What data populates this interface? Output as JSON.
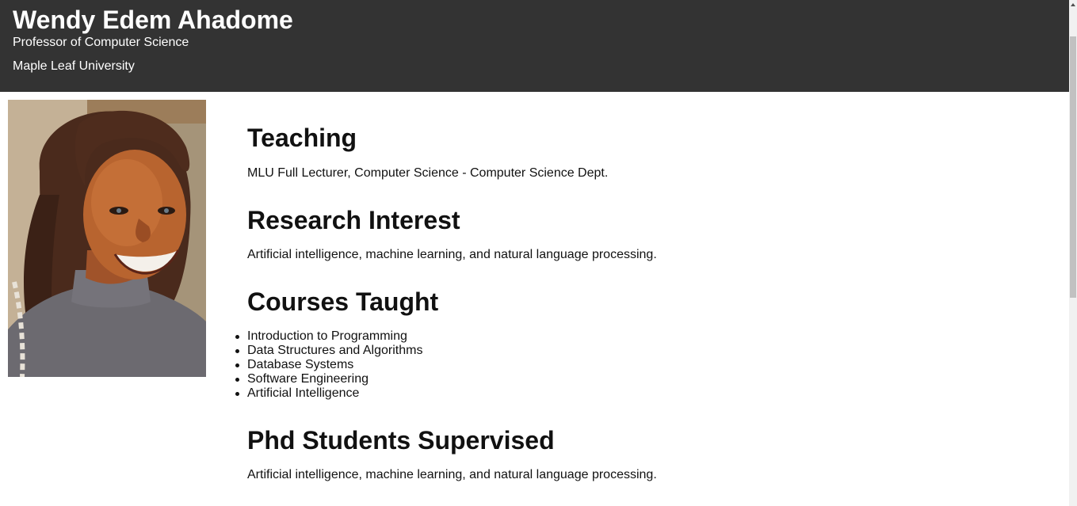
{
  "header": {
    "name": "Wendy Edem Ahadome",
    "title": "Professor of Computer Science",
    "university": "Maple Leaf University"
  },
  "photo": {
    "icon": "profile-photo"
  },
  "sections": {
    "teaching": {
      "heading": "Teaching",
      "text": "MLU Full Lecturer, Computer Science - Computer Science Dept."
    },
    "research": {
      "heading": "Research Interest",
      "text": "Artificial intelligence, machine learning, and natural language processing."
    },
    "courses": {
      "heading": "Courses Taught",
      "items": [
        "Introduction to Programming",
        "Data Structures and Algorithms",
        "Database Systems",
        "Software Engineering",
        "Artificial Intelligence"
      ]
    },
    "phd": {
      "heading": "Phd Students Supervised",
      "text": "Artificial intelligence, machine learning, and natural language processing."
    }
  },
  "colors": {
    "header_bg": "#333333",
    "header_text": "#ffffff",
    "body_text": "#111111"
  }
}
